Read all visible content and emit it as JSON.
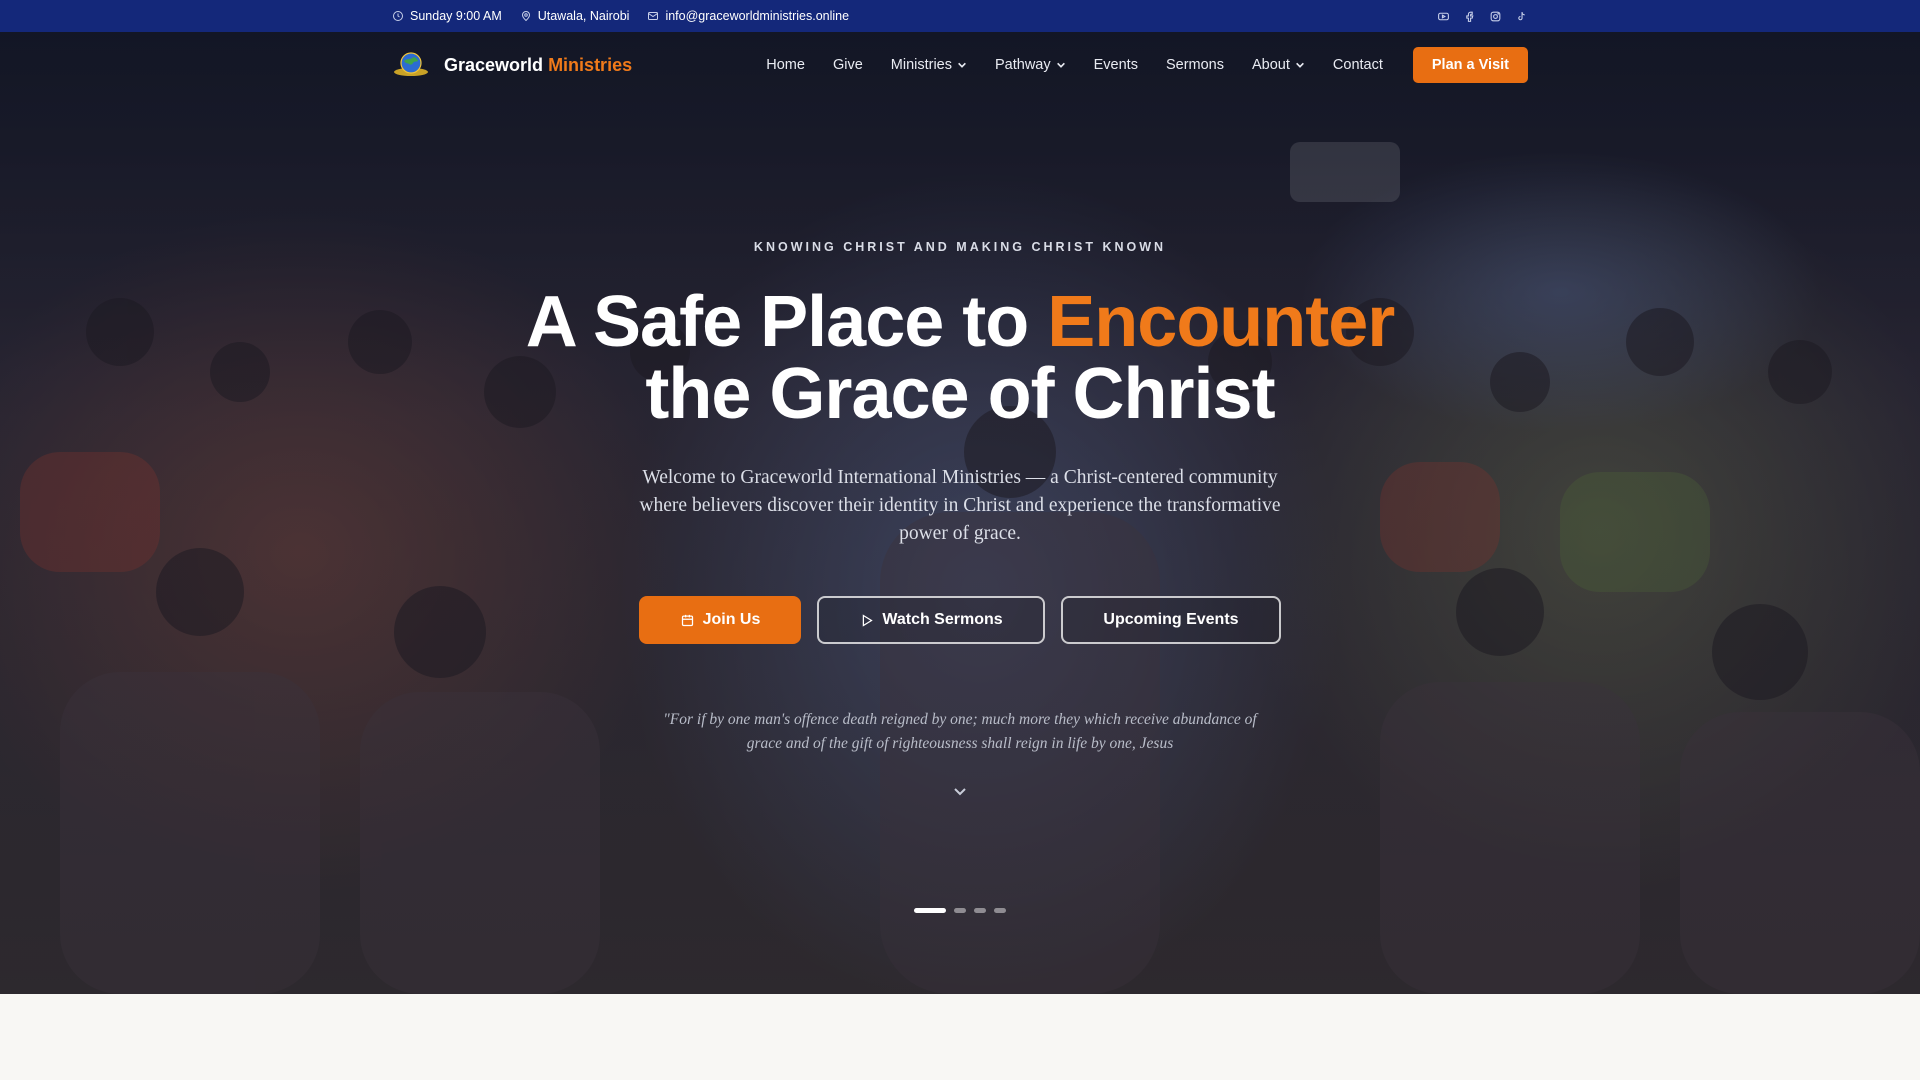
{
  "topbar": {
    "service_time": "Sunday 9:00 AM",
    "location": "Utawala, Nairobi",
    "email": "info@graceworldministries.online",
    "social_icons": [
      "youtube-icon",
      "facebook-icon",
      "instagram-icon",
      "tiktok-icon"
    ]
  },
  "brand": {
    "name_main": "Graceworld",
    "name_accent": "Ministries"
  },
  "nav": {
    "items": [
      "Home",
      "Give",
      "Ministries",
      "Pathway",
      "Events",
      "Sermons",
      "About",
      "Contact"
    ],
    "cta": "Plan a Visit"
  },
  "hero": {
    "eyebrow": "KNOWING CHRIST AND MAKING CHRIST KNOWN",
    "headline_part1": "A Safe Place to",
    "headline_accent": "Encounter",
    "headline_line2": "the Grace of Christ",
    "lead": "Welcome to Graceworld International Ministries — a Christ-centered community where believers discover their identity in Christ and experience the transformative power of grace.",
    "buttons": {
      "join": "Join Us",
      "watch": "Watch Sermons",
      "events": "Upcoming Events"
    },
    "verse": "\"For if by one man's offence death reigned by one; much more they which receive abundance of grace and of the gift of righteousness shall reign in life by one, Jesus",
    "slides_total": 4,
    "slide_active": 1
  },
  "colors": {
    "topbar_bg": "#14287a",
    "accent": "#e86e12",
    "accent_text": "#f07a1a",
    "page_bg": "#f8f7f4"
  }
}
